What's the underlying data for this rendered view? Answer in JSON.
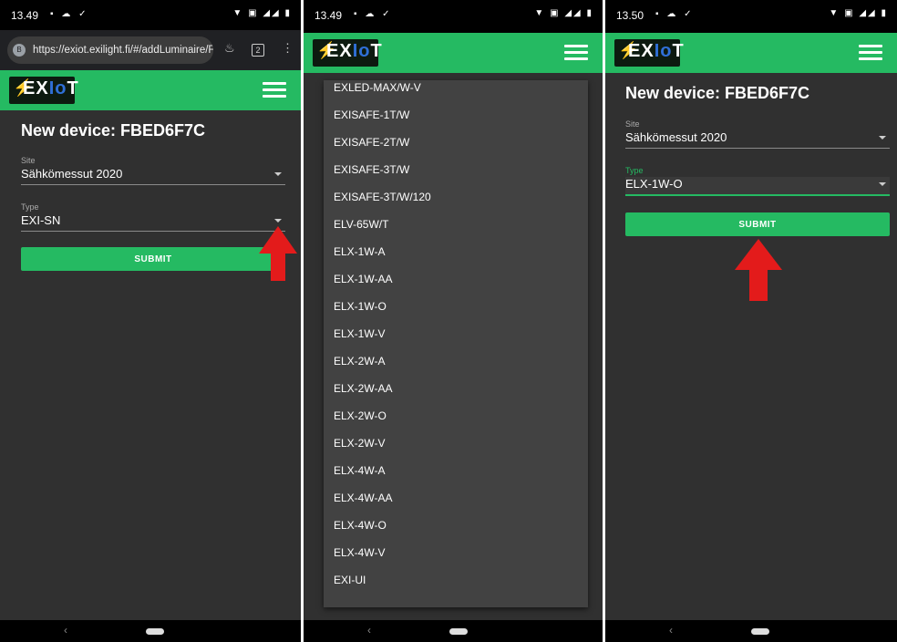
{
  "panel1": {
    "status_time": "13.49",
    "url": "https://exiot.exilight.fi/#/addLuminaire/FB",
    "tab_count": "2",
    "logo_text": "EXIoT",
    "title": "New device: FBED6F7C",
    "site_label": "Site",
    "site_value": "Sähkömessut 2020",
    "type_label": "Type",
    "type_value": "EXI-SN",
    "submit_label": "SUBMIT"
  },
  "panel2": {
    "status_time": "13.49",
    "logo_text": "EXIoT",
    "options": [
      "EXLED-MAX/W-V",
      "EXISAFE-1T/W",
      "EXISAFE-2T/W",
      "EXISAFE-3T/W",
      "EXISAFE-3T/W/120",
      "ELV-65W/T",
      "ELX-1W-A",
      "ELX-1W-AA",
      "ELX-1W-O",
      "ELX-1W-V",
      "ELX-2W-A",
      "ELX-2W-AA",
      "ELX-2W-O",
      "ELX-2W-V",
      "ELX-4W-A",
      "ELX-4W-AA",
      "ELX-4W-O",
      "ELX-4W-V",
      "EXI-UI"
    ]
  },
  "panel3": {
    "status_time": "13.50",
    "logo_text": "EXIoT",
    "title": "New device: FBED6F7C",
    "site_label": "Site",
    "site_value": "Sähkömessut 2020",
    "type_label": "Type",
    "type_value": "ELX-1W-O",
    "submit_label": "SUBMIT"
  },
  "colors": {
    "brand_green": "#25ba62",
    "background": "#303030",
    "arrow_red": "#e31b1b",
    "dropdown_bg": "#424242"
  },
  "icons": {
    "menu": "hamburger-icon",
    "dropdown": "caret-down-icon",
    "annotation": "red-arrow-icon"
  }
}
